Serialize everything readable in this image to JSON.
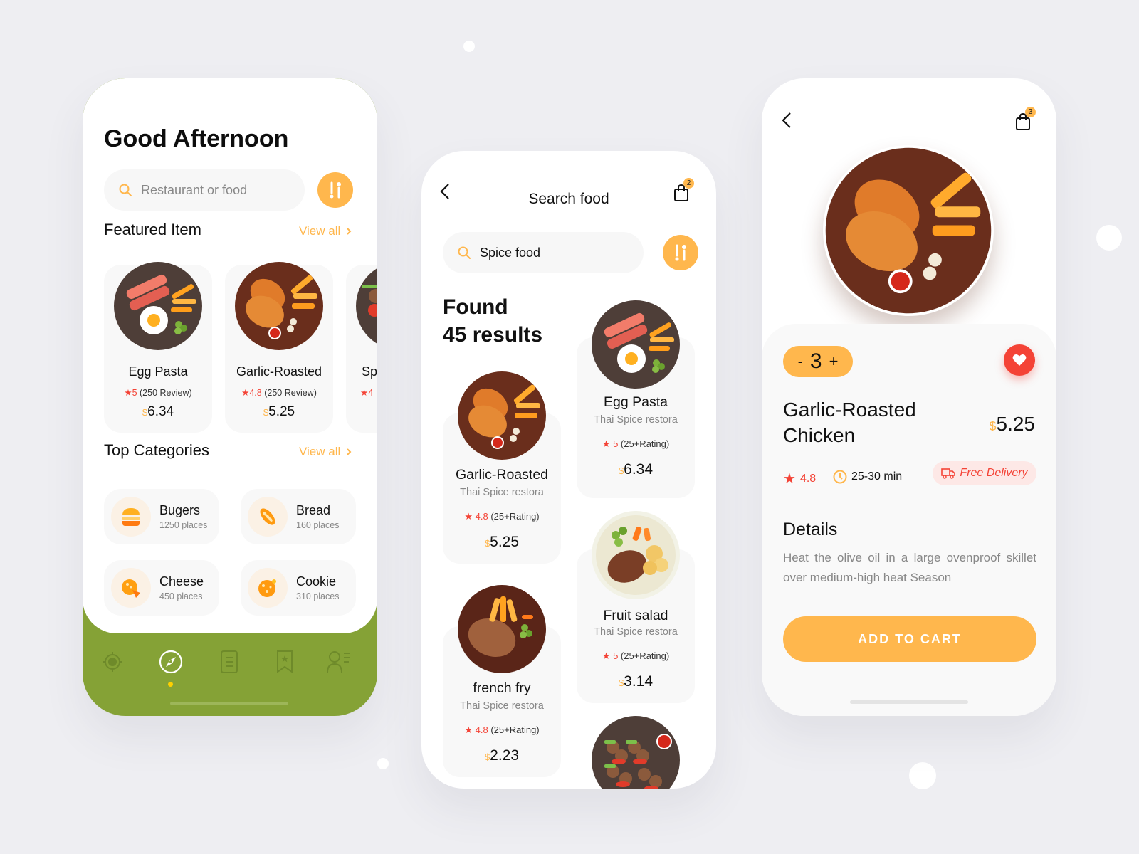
{
  "colors": {
    "accent": "#ffb74d",
    "nav_bg": "#85a236",
    "rating_red": "#f44336",
    "background": "#eeeef2"
  },
  "home": {
    "greeting": "Good Afternoon",
    "search_placeholder": "Restaurant or food",
    "featured_title": "Featured Item",
    "view_all": "View all",
    "featured": [
      {
        "name": "Egg Pasta",
        "rating": "5",
        "reviews": "(250 Review)",
        "currency": "$",
        "price": "6.34"
      },
      {
        "name": "Garlic-Roasted",
        "rating": "4.8",
        "reviews": "(250 Review)",
        "currency": "$",
        "price": "5.25"
      },
      {
        "name": "Sp",
        "rating": "4",
        "reviews": "",
        "currency": "",
        "price": ""
      }
    ],
    "categories_title": "Top Categories",
    "categories": [
      {
        "name": "Bugers",
        "places": "1250 places",
        "icon": "burger-icon"
      },
      {
        "name": "Bread",
        "places": "160 places",
        "icon": "bread-icon"
      },
      {
        "name": "Cheese",
        "places": "450 places",
        "icon": "cheese-icon"
      },
      {
        "name": "Cookie",
        "places": "310 places",
        "icon": "cookie-icon"
      }
    ],
    "nav": [
      "location-icon",
      "compass-icon",
      "document-icon",
      "bookmark-icon",
      "profile-icon"
    ],
    "nav_active": 1
  },
  "search": {
    "title": "Search food",
    "cart_count": "2",
    "query": "Spice food",
    "found_line1": "Found",
    "found_line2": "45 results",
    "results": [
      {
        "name": "Garlic-Roasted",
        "restaurant": "Thai Spice restora",
        "rating": "4.8",
        "rating_count": "(25+Rating)",
        "currency": "$",
        "price": "5.25"
      },
      {
        "name": "Egg Pasta",
        "restaurant": "Thai Spice restora",
        "rating": "5",
        "rating_count": "(25+Rating)",
        "currency": "$",
        "price": "6.34"
      },
      {
        "name": "french fry",
        "restaurant": "Thai Spice restora",
        "rating": "4.8",
        "rating_count": "(25+Rating)",
        "currency": "$",
        "price": "2.23"
      },
      {
        "name": "Fruit salad",
        "restaurant": "Thai Spice restora",
        "rating": "5",
        "rating_count": "(25+Rating)",
        "currency": "$",
        "price": "3.14"
      }
    ]
  },
  "detail": {
    "cart_count": "3",
    "qty_minus": "-",
    "qty": "3",
    "qty_plus": "+",
    "title_line1": "Garlic-Roasted",
    "title_line2": "Chicken",
    "currency": "$",
    "price": "5.25",
    "rating": "4.8",
    "time": "25-30 min",
    "delivery": "Free Delivery",
    "details_title": "Details",
    "details_text": "Heat the olive oil in a large ovenproof skillet over medium-high heat Season",
    "add_to_cart": "ADD TO CART"
  }
}
